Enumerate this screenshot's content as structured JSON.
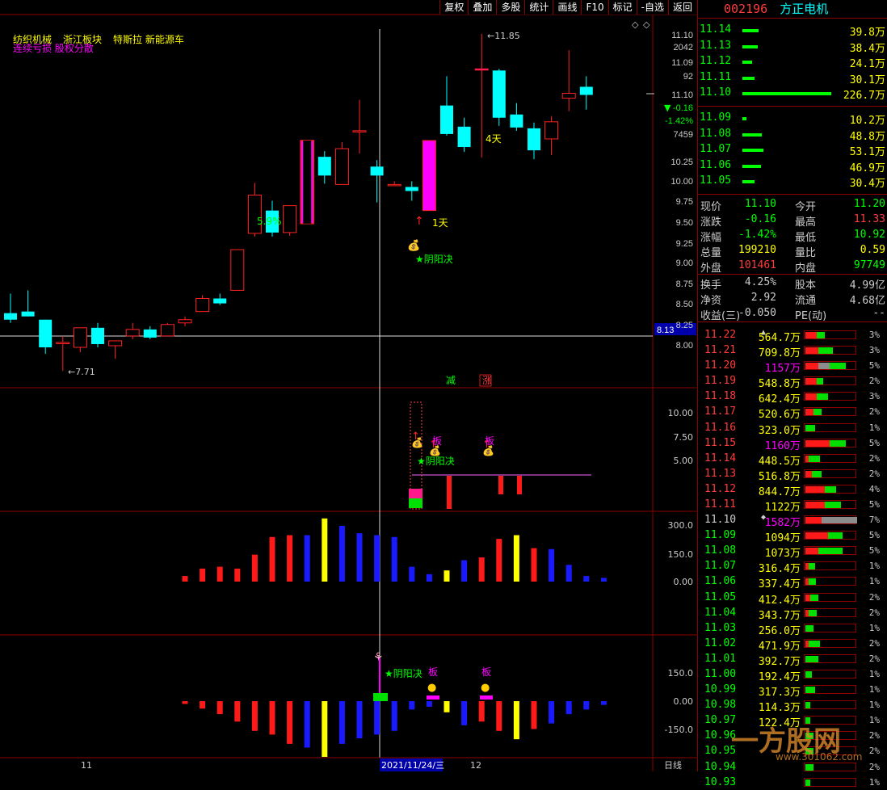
{
  "toolbar": [
    "复权",
    "叠加",
    "多股",
    "统计",
    "画线",
    "F10",
    "标记",
    "-自选",
    "返回"
  ],
  "tags": [
    "纺织机械",
    "浙江板块",
    "特斯拉 新能源车"
  ],
  "tag_sub": "连续亏损 股权分散",
  "chart_data": {
    "type": "candlestick",
    "candles": [
      {
        "o": 8.42,
        "h": 8.66,
        "l": 8.3,
        "c": 8.34
      },
      {
        "o": 8.44,
        "h": 8.7,
        "l": 8.38,
        "c": 8.38
      },
      {
        "o": 8.34,
        "h": 8.34,
        "l": 7.92,
        "c": 8.0
      },
      {
        "o": 8.06,
        "h": 8.14,
        "l": 7.71,
        "c": 8.06
      },
      {
        "o": 8.0,
        "h": 8.22,
        "l": 7.94,
        "c": 8.24
      },
      {
        "o": 8.24,
        "h": 8.3,
        "l": 8.0,
        "c": 8.04
      },
      {
        "o": 8.02,
        "h": 8.06,
        "l": 7.86,
        "c": 8.08
      },
      {
        "o": 8.14,
        "h": 8.3,
        "l": 8.1,
        "c": 8.22
      },
      {
        "o": 8.22,
        "h": 8.26,
        "l": 8.1,
        "c": 8.12
      },
      {
        "o": 8.14,
        "h": 8.3,
        "l": 8.14,
        "c": 8.28
      },
      {
        "o": 8.3,
        "h": 8.38,
        "l": 8.26,
        "c": 8.34
      },
      {
        "o": 8.44,
        "h": 8.64,
        "l": 8.44,
        "c": 8.6
      },
      {
        "o": 8.6,
        "h": 8.66,
        "l": 8.52,
        "c": 8.54
      },
      {
        "o": 8.7,
        "h": 9.2,
        "l": 8.7,
        "c": 9.2
      },
      {
        "o": 9.4,
        "h": 10.02,
        "l": 9.36,
        "c": 9.87
      },
      {
        "o": 9.68,
        "h": 9.8,
        "l": 9.36,
        "c": 9.41
      },
      {
        "o": 9.41,
        "h": 9.74,
        "l": 9.37,
        "c": 9.74
      },
      {
        "o": 9.52,
        "h": 10.54,
        "l": 9.52,
        "c": 10.54
      },
      {
        "o": 10.34,
        "h": 10.41,
        "l": 10.01,
        "c": 10.11
      },
      {
        "o": 10.0,
        "h": 10.52,
        "l": 10.0,
        "c": 10.44
      },
      {
        "o": 10.66,
        "h": 11.04,
        "l": 10.38,
        "c": 10.66
      },
      {
        "o": 10.22,
        "h": 10.3,
        "l": 9.78,
        "c": 10.11
      },
      {
        "o": 10.0,
        "h": 10.04,
        "l": 9.98,
        "c": 10.0
      },
      {
        "o": 9.97,
        "h": 10.04,
        "l": 9.8,
        "c": 9.92
      },
      {
        "o": 9.68,
        "h": 10.54,
        "l": 9.68,
        "c": 10.54
      },
      {
        "o": 10.97,
        "h": 11.33,
        "l": 10.6,
        "c": 10.62
      },
      {
        "o": 10.71,
        "h": 10.82,
        "l": 10.4,
        "c": 10.46
      },
      {
        "o": 11.42,
        "h": 11.85,
        "l": 10.33,
        "c": 11.42
      },
      {
        "o": 11.4,
        "h": 11.42,
        "l": 10.72,
        "c": 10.82
      },
      {
        "o": 10.86,
        "h": 11.0,
        "l": 10.66,
        "c": 10.7
      },
      {
        "o": 10.69,
        "h": 10.76,
        "l": 10.31,
        "c": 10.42
      },
      {
        "o": 10.56,
        "h": 10.84,
        "l": 10.36,
        "c": 10.77
      },
      {
        "o": 11.06,
        "h": 11.65,
        "l": 10.9,
        "c": 11.12
      },
      {
        "o": 11.2,
        "h": 11.33,
        "l": 10.92,
        "c": 11.1
      }
    ],
    "magenta_idx": [
      24,
      27
    ],
    "red_magenta_idx": [
      17
    ],
    "y_ticks": [
      "11.10",
      "2042",
      "11.09",
      "92",
      "11.10",
      "-0.16",
      "-1.42%",
      "7459",
      "10.25",
      "10.00",
      "9.75",
      "9.50",
      "9.25",
      "9.00",
      "8.75",
      "8.50",
      "8.25",
      "8.00"
    ],
    "price_tag": "8.13",
    "hi_label": "11.85",
    "lo_label": "7.71",
    "ann_59": "5.9%",
    "ann_4days": "4天",
    "ann_1day": "1天",
    "ann_yinyang": "★阴阳决",
    "ann_jian": "减",
    "ann_zhang": "涨",
    "ann_ban": "板",
    "p2_ticks": [
      "10.00",
      "7.50",
      "5.00"
    ],
    "p3_ticks": [
      "300.0",
      "150.0",
      "0.00"
    ],
    "p3_values": [
      30,
      70,
      80,
      70,
      145,
      240,
      250,
      250,
      340,
      300,
      260,
      250,
      240,
      80,
      40,
      60,
      115,
      130,
      230,
      250,
      180,
      175,
      90,
      30,
      20
    ],
    "p3_colors": [
      "red",
      "red",
      "red",
      "red",
      "red",
      "red",
      "red",
      "blue",
      "yellow",
      "blue",
      "blue",
      "blue",
      "blue",
      "blue",
      "blue",
      "yellow",
      "blue",
      "red",
      "red",
      "yellow",
      "red",
      "blue",
      "blue",
      "blue",
      "blue"
    ],
    "p4_ticks": [
      "150.0",
      "0.00",
      "-150.0"
    ],
    "p4_values": [
      -15,
      -40,
      -70,
      -110,
      -160,
      -180,
      -230,
      -250,
      -300,
      -230,
      -200,
      -180,
      -160,
      -45,
      -30,
      -60,
      -130,
      -110,
      -160,
      -205,
      -150,
      -120,
      -70,
      -45,
      -20
    ],
    "x_labels": [
      "11",
      "2021/11/24/三",
      "12"
    ],
    "period": "日线"
  },
  "stock": {
    "code": "002196",
    "name": "方正电机"
  },
  "asks": [
    {
      "price": "11.14",
      "vol": "39.8万",
      "w": 20
    },
    {
      "price": "11.13",
      "vol": "38.4万",
      "w": 19
    },
    {
      "price": "11.12",
      "vol": "24.1万",
      "w": 12
    },
    {
      "price": "11.11",
      "vol": "30.1万",
      "w": 15
    },
    {
      "price": "11.10",
      "vol": "226.7万",
      "w": 110
    }
  ],
  "bids": [
    {
      "price": "11.09",
      "vol": "10.2万",
      "w": 5
    },
    {
      "price": "11.08",
      "vol": "48.8万",
      "w": 24
    },
    {
      "price": "11.07",
      "vol": "53.1万",
      "w": 26
    },
    {
      "price": "11.06",
      "vol": "46.9万",
      "w": 23
    },
    {
      "price": "11.05",
      "vol": "30.4万",
      "w": 15
    }
  ],
  "quote": [
    {
      "l1": "现价",
      "v1": "11.10",
      "c1": "#00ff00",
      "l2": "今开",
      "v2": "11.20",
      "c2": "#00ff00"
    },
    {
      "l1": "涨跌",
      "v1": "-0.16",
      "c1": "#00ff00",
      "l2": "最高",
      "v2": "11.33",
      "c2": "#ff3b3b"
    },
    {
      "l1": "涨幅",
      "v1": "-1.42%",
      "c1": "#00ff00",
      "l2": "最低",
      "v2": "10.92",
      "c2": "#00ff00"
    },
    {
      "l1": "总量",
      "v1": "199210",
      "c1": "#ffff00",
      "l2": "量比",
      "v2": "0.59",
      "c2": "#ffff00"
    },
    {
      "l1": "外盘",
      "v1": "101461",
      "c1": "#ff3b3b",
      "l2": "内盘",
      "v2": "97749",
      "c2": "#00ff00"
    },
    {
      "l1": "换手",
      "v1": "4.25%",
      "c1": "#ccc",
      "l2": "股本",
      "v2": "4.99亿",
      "c2": "#ccc"
    },
    {
      "l1": "净资",
      "v1": "2.92",
      "c1": "#ccc",
      "l2": "流通",
      "v2": "4.68亿",
      "c2": "#ccc"
    },
    {
      "l1": "收益(三)",
      "v1": "-0.050",
      "c1": "#ccc",
      "l2": "PE(动)",
      "v2": "--",
      "c2": "#ccc"
    }
  ],
  "dist": [
    {
      "p": "11.22",
      "v": "564.7万",
      "pct": "3%",
      "r": 14,
      "g": 10,
      "x": 0,
      "m": "▲"
    },
    {
      "p": "11.21",
      "v": "709.8万",
      "pct": "3%",
      "r": 16,
      "g": 18,
      "x": 0
    },
    {
      "p": "11.20",
      "v": "1157万",
      "pct": "5%",
      "r": 16,
      "g": 20,
      "x": 14,
      "vc": "#ff00ff"
    },
    {
      "p": "11.19",
      "v": "548.8万",
      "pct": "2%",
      "r": 14,
      "g": 8,
      "x": 0
    },
    {
      "p": "11.18",
      "v": "642.4万",
      "pct": "3%",
      "r": 14,
      "g": 14,
      "x": 0
    },
    {
      "p": "11.17",
      "v": "520.6万",
      "pct": "2%",
      "r": 10,
      "g": 10,
      "x": 0
    },
    {
      "p": "11.16",
      "v": "323.0万",
      "pct": "1%",
      "r": 0,
      "g": 12,
      "x": 0
    },
    {
      "p": "11.15",
      "v": "1160万",
      "pct": "5%",
      "r": 30,
      "g": 20,
      "x": 0,
      "vc": "#ff00ff"
    },
    {
      "p": "11.14",
      "v": "448.5万",
      "pct": "2%",
      "r": 4,
      "g": 14,
      "x": 0
    },
    {
      "p": "11.13",
      "v": "516.8万",
      "pct": "2%",
      "r": 8,
      "g": 12,
      "x": 0
    },
    {
      "p": "11.12",
      "v": "844.7万",
      "pct": "4%",
      "r": 24,
      "g": 14,
      "x": 0
    },
    {
      "p": "11.11",
      "v": "1122万",
      "pct": "5%",
      "r": 24,
      "g": 20,
      "x": 0
    },
    {
      "p": "11.10",
      "v": "1582万",
      "pct": "7%",
      "r": 20,
      "g": 0,
      "x": 44,
      "m": "◆",
      "vc": "#ff00ff"
    },
    {
      "p": "11.09",
      "v": "1094万",
      "pct": "5%",
      "r": 28,
      "g": 18,
      "x": 0
    },
    {
      "p": "11.08",
      "v": "1073万",
      "pct": "5%",
      "r": 16,
      "g": 30,
      "x": 0
    },
    {
      "p": "11.07",
      "v": "316.4万",
      "pct": "1%",
      "r": 4,
      "g": 8,
      "x": 0
    },
    {
      "p": "11.06",
      "v": "337.4万",
      "pct": "1%",
      "r": 4,
      "g": 9,
      "x": 0
    },
    {
      "p": "11.05",
      "v": "412.4万",
      "pct": "2%",
      "r": 6,
      "g": 10,
      "x": 0
    },
    {
      "p": "11.04",
      "v": "343.7万",
      "pct": "2%",
      "r": 4,
      "g": 10,
      "x": 0
    },
    {
      "p": "11.03",
      "v": "256.0万",
      "pct": "1%",
      "r": 0,
      "g": 10,
      "x": 0
    },
    {
      "p": "11.02",
      "v": "471.9万",
      "pct": "2%",
      "r": 4,
      "g": 14,
      "x": 0
    },
    {
      "p": "11.01",
      "v": "392.7万",
      "pct": "2%",
      "r": 0,
      "g": 16,
      "x": 0
    },
    {
      "p": "11.00",
      "v": "192.4万",
      "pct": "1%",
      "r": 0,
      "g": 8,
      "x": 0
    },
    {
      "p": "10.99",
      "v": "317.3万",
      "pct": "1%",
      "r": 0,
      "g": 12,
      "x": 0
    },
    {
      "p": "10.98",
      "v": "114.3万",
      "pct": "1%",
      "r": 0,
      "g": 6,
      "x": 0
    },
    {
      "p": "10.97",
      "v": "122.4万",
      "pct": "1%",
      "r": 0,
      "g": 6,
      "x": 0
    },
    {
      "p": "10.96",
      "v": "",
      "pct": "2%",
      "r": 0,
      "g": 10,
      "x": 0
    },
    {
      "p": "10.95",
      "v": "",
      "pct": "2%",
      "r": 0,
      "g": 10,
      "x": 0
    },
    {
      "p": "10.94",
      "v": "",
      "pct": "2%",
      "r": 0,
      "g": 10,
      "x": 0
    },
    {
      "p": "10.93",
      "v": "",
      "pct": "1%",
      "r": 0,
      "g": 6,
      "x": 0
    }
  ],
  "watermark": "一方股网",
  "watermark_url": "www.301062.com"
}
